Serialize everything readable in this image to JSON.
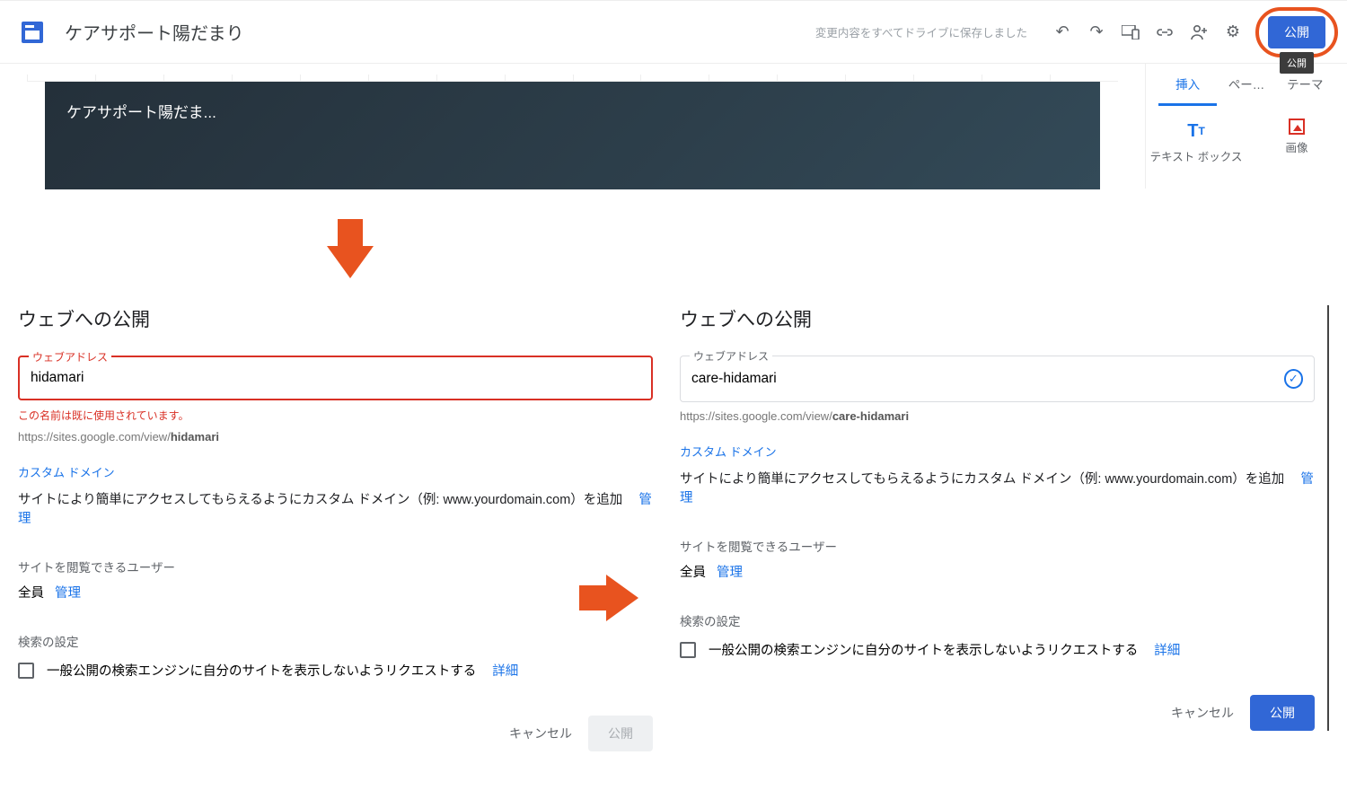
{
  "app": {
    "site_name": "ケアサポート陽だまり",
    "save_status": "変更内容をすべてドライブに保存しました",
    "publish_label": "公開",
    "publish_tooltip": "公開"
  },
  "tabs": {
    "insert": "挿入",
    "pages": "ペー…",
    "theme": "テーマ"
  },
  "widgets": {
    "textbox": "テキスト ボックス",
    "image": "画像"
  },
  "hero_title": "ケアサポート陽だま...",
  "dialog_left": {
    "title": "ウェブへの公開",
    "field_label": "ウェブアドレス",
    "value": "hidamari",
    "error": "この名前は既に使用されています。",
    "url_prefix": "https://sites.google.com/view/",
    "url_slug": "hidamari",
    "custom_domain_label": "カスタム ドメイン",
    "custom_domain_body": "サイトにより簡単にアクセスしてもらえるようにカスタム ドメイン（例: www.yourdomain.com）を追加",
    "manage": "管理",
    "viewers_label": "サイトを閲覧できるユーザー",
    "viewers_value": "全員",
    "search_label": "検索の設定",
    "search_check": "一般公開の検索エンジンに自分のサイトを表示しないようリクエストする",
    "details": "詳細",
    "cancel": "キャンセル",
    "submit": "公開"
  },
  "dialog_right": {
    "title": "ウェブへの公開",
    "field_label": "ウェブアドレス",
    "value": "care-hidamari",
    "url_prefix": "https://sites.google.com/view/",
    "url_slug": "care-hidamari",
    "custom_domain_label": "カスタム ドメイン",
    "custom_domain_body": "サイトにより簡単にアクセスしてもらえるようにカスタム ドメイン（例: www.yourdomain.com）を追加",
    "manage": "管理",
    "viewers_label": "サイトを閲覧できるユーザー",
    "viewers_value": "全員",
    "search_label": "検索の設定",
    "search_check": "一般公開の検索エンジンに自分のサイトを表示しないようリクエストする",
    "details": "詳細",
    "cancel": "キャンセル",
    "submit": "公開"
  }
}
